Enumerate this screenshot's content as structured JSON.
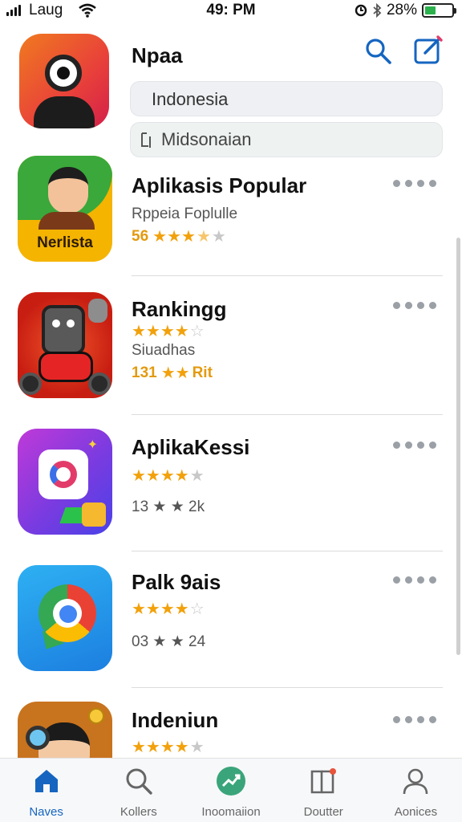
{
  "status_bar": {
    "carrier": "Laug",
    "time": "49: PM",
    "battery": "28%"
  },
  "header": {
    "title": "Npaa",
    "country_field": "Indonesia",
    "language_field": "Midsonaian"
  },
  "apps": [
    {
      "name": "Aplikasis Popular",
      "subtitle": "Rppeia Foplulle",
      "rating_text": "56",
      "stars": 3.5,
      "icon_label": "Nerlista",
      "icon": "cartoon-boy-icon"
    },
    {
      "name": "Rankingg",
      "subtitle": "Siuadhas",
      "rating_text": "131",
      "stars": 4,
      "second_rating_suffix": "Rit",
      "icon": "robot-mascot-icon"
    },
    {
      "name": "AplikaKessi",
      "stars": 4,
      "count_text": "13 ★ ★ 2k",
      "icon": "chat-bubble-icon"
    },
    {
      "name": "Palk 9ais",
      "stars": 4,
      "count_text": "03 ★ ★ 24",
      "icon": "chrome-bubble-icon"
    },
    {
      "name": "Indeniun",
      "stars": 4,
      "icon": "explorer-kid-icon"
    }
  ],
  "tabs": [
    {
      "label": "Naves",
      "icon": "home-icon",
      "active": true
    },
    {
      "label": "Kollers",
      "icon": "search-icon",
      "active": false
    },
    {
      "label": "Inoomaiion",
      "icon": "trending-icon",
      "active": false
    },
    {
      "label": "Doutter",
      "icon": "book-icon",
      "active": false
    },
    {
      "label": "Aonices",
      "icon": "person-icon",
      "active": false
    }
  ],
  "colors": {
    "accent": "#1565c0",
    "star": "#f2a10c",
    "star_off": "#c8c8c8"
  }
}
